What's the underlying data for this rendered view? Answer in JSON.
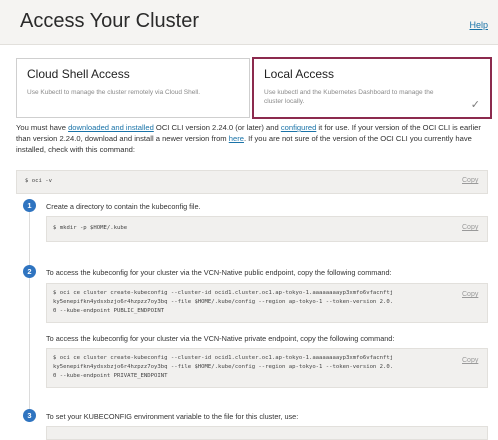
{
  "page": {
    "title": "Access Your Cluster",
    "help_link": "Help"
  },
  "tabs": [
    {
      "title": "Cloud Shell Access",
      "description": "Use Kubectl to manage the cluster remotely via Cloud Shell."
    },
    {
      "title": "Local Access",
      "description": "Use kubectl and the Kubernetes Dashboard to manage the cluster locally.",
      "selected": true
    }
  ],
  "intro": {
    "t1": "You must have ",
    "link1": "downloaded and installed",
    "t2": " OCI CLI version 2.24.0 (or later) and ",
    "link2": "configured",
    "t3": " it for use. If your version of the OCI CLI is earlier than version 2.24.0, download and install a newer version from ",
    "link3": "here",
    "t4": ". If you are not sure of the version of the OCI CLI you currently have installed, check with this command:"
  },
  "version_cmd": "$ oci -v",
  "copy_label": "Copy",
  "steps": [
    {
      "number": "1",
      "text": "Create a directory to contain the kubeconfig file.",
      "command": "$ mkdir -p $HOME/.kube"
    },
    {
      "number": "2",
      "text_public": "To access the kubeconfig for your cluster via the VCN-Native public endpoint, copy the following command:",
      "command_public": "$ oci ce cluster create-kubeconfig --cluster-id ocid1.cluster.oc1.ap-tokyo-1.aaaaaaaayp3xmfo6vfacnftj\nky5enepifkn4ydsxbzjo6r4hzpzz7oy3bq --file $HOME/.kube/config --region ap-tokyo-1 --token-version 2.0.\n0 --kube-endpoint PUBLIC_ENDPOINT",
      "text_private": "To access the kubeconfig for your cluster via the VCN-Native private endpoint, copy the following command:",
      "command_private": "$ oci ce cluster create-kubeconfig --cluster-id ocid1.cluster.oc1.ap-tokyo-1.aaaaaaaayp3xmfo6vfacnftj\nky5enepifkn4ydsxbzjo6r4hzpzz7oy3bq --file $HOME/.kube/config --region ap-tokyo-1 --token-version 2.0.\n0 --kube-endpoint PRIVATE_ENDPOINT"
    },
    {
      "number": "3",
      "text": "To set your KUBECONFIG environment variable to the file for this cluster, use:"
    }
  ],
  "colors": {
    "accent": "#8c2a4e",
    "step_badge": "#2f74c0",
    "link": "#1a73a8"
  }
}
